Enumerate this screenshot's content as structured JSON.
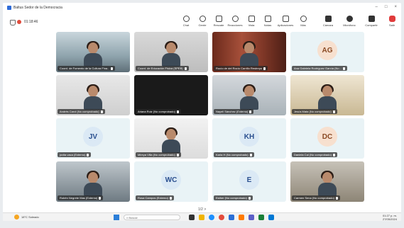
{
  "window": {
    "title": "Baltus Sedor de la Democracia"
  },
  "meeting": {
    "timer": "01:18:46",
    "toolbar": [
      {
        "label": "Chat",
        "icon": "chat-icon"
      },
      {
        "label": "Gente",
        "icon": "people-icon"
      },
      {
        "label": "Rescate",
        "icon": "raise-hand-icon"
      },
      {
        "label": "Reacciones",
        "icon": "reactions-icon"
      },
      {
        "label": "Vista",
        "icon": "view-icon"
      },
      {
        "label": "Notas",
        "icon": "notes-icon"
      },
      {
        "label": "Aplicaciones",
        "icon": "apps-icon"
      },
      {
        "label": "Más",
        "icon": "more-icon"
      },
      {
        "label": "Cámara",
        "icon": "camera-icon"
      },
      {
        "label": "Micrófono",
        "icon": "microphone-icon"
      },
      {
        "label": "Compartir",
        "icon": "share-icon"
      },
      {
        "label": "Salir",
        "icon": "leave-icon"
      }
    ],
    "participants": [
      {
        "name": "Coord. de Fomento de la Cultura Fina...",
        "type": "video",
        "style": "video1"
      },
      {
        "name": "Coord. de Educación Física (SPEB)",
        "type": "video",
        "style": "video2"
      },
      {
        "name": "Rocío de del Rocío Carrillo Restrepo",
        "type": "video",
        "style": "video3"
      },
      {
        "name": "Ana Gabriela Rodríguez García (No...",
        "type": "avatar",
        "initials": "AG",
        "style": "peach"
      },
      {
        "name": "Andrés Carol (No comprobado)",
        "type": "video",
        "style": "video4"
      },
      {
        "name": "Ariana Ruiz (No comprobado)",
        "type": "video",
        "style": "video5"
      },
      {
        "name": "Nayeli Sánchez (Externo)",
        "type": "video",
        "style": "video6"
      },
      {
        "name": "Jesús Mata (No comprobado)",
        "type": "video",
        "style": "video7"
      },
      {
        "name": "jovita vaca (Externo)",
        "type": "avatar",
        "initials": "JV",
        "style": "blue"
      },
      {
        "name": "Mireya Villa (No comprobado)",
        "type": "video",
        "style": "video8"
      },
      {
        "name": "Karla H (No comprobado)",
        "type": "avatar",
        "initials": "KH",
        "style": "blue"
      },
      {
        "name": "Daniela Cal (No comprobado)",
        "type": "avatar",
        "initials": "DC",
        "style": "peach"
      },
      {
        "name": "Rubén Negrete Mas (Externo)",
        "type": "video",
        "style": "video9"
      },
      {
        "name": "Rosa Campos (Externo)",
        "type": "avatar",
        "initials": "WC",
        "style": "blue"
      },
      {
        "name": "Esther (No comprobado)",
        "type": "avatar",
        "initials": "E",
        "style": "blue"
      },
      {
        "name": "Carmen Sena (No comprobado)",
        "type": "video",
        "style": "video10"
      }
    ],
    "pager": "1/2 >"
  },
  "taskbar": {
    "weather_temp": "18°C",
    "weather_desc": "Soleado",
    "search_placeholder": "Buscar",
    "time": "01:27 p. m.",
    "date": "27/05/2024"
  }
}
